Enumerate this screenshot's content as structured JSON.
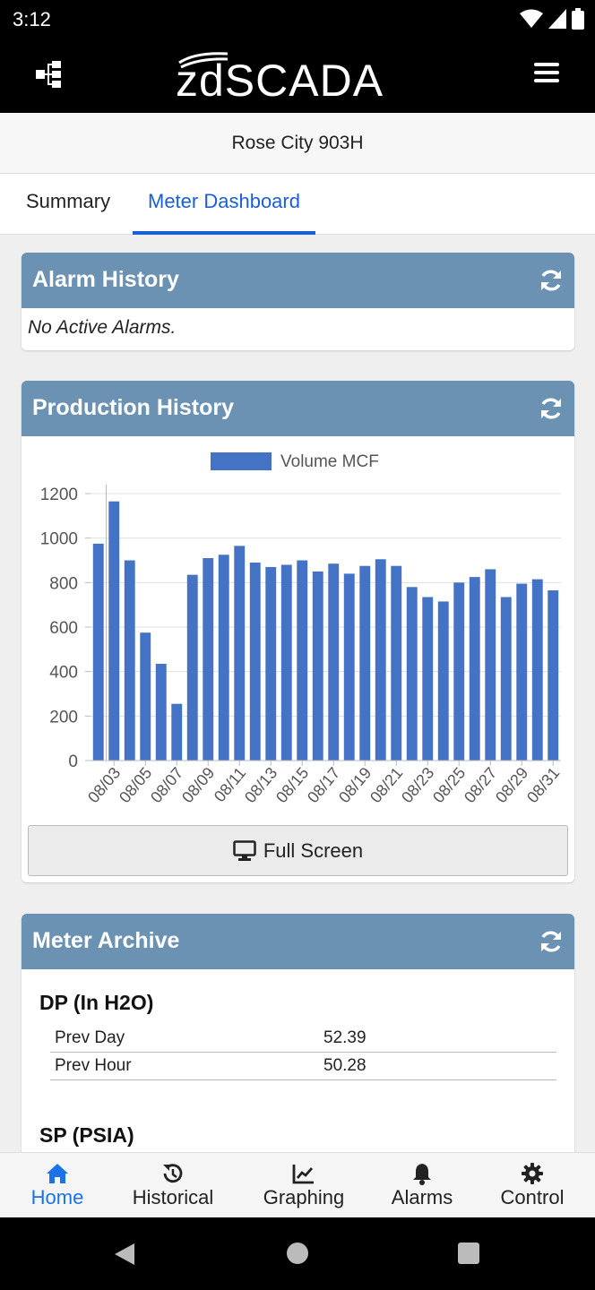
{
  "status_bar": {
    "time": "3:12"
  },
  "header": {
    "logo_text": "zdSCADA"
  },
  "site": {
    "title": "Rose City 903H"
  },
  "tabs": [
    {
      "label": "Summary",
      "active": false
    },
    {
      "label": "Meter Dashboard",
      "active": true
    }
  ],
  "alarm_history": {
    "title": "Alarm History",
    "message": "No Active Alarms."
  },
  "production_history": {
    "title": "Production History",
    "full_screen_label": "Full Screen"
  },
  "chart_data": {
    "type": "bar",
    "legend": [
      "Volume MCF"
    ],
    "legend_position": "top",
    "categories": [
      "08/02",
      "08/03",
      "08/04",
      "08/05",
      "08/06",
      "08/07",
      "08/08",
      "08/09",
      "08/10",
      "08/11",
      "08/12",
      "08/13",
      "08/14",
      "08/15",
      "08/16",
      "08/17",
      "08/18",
      "08/19",
      "08/20",
      "08/21",
      "08/22",
      "08/23",
      "08/24",
      "08/25",
      "08/26",
      "08/27",
      "08/28",
      "08/29",
      "08/30",
      "08/31"
    ],
    "tick_labels": [
      "08/03",
      "08/05",
      "08/07",
      "08/09",
      "08/11",
      "08/13",
      "08/15",
      "08/17",
      "08/19",
      "08/21",
      "08/23",
      "08/25",
      "08/27",
      "08/29",
      "08/31"
    ],
    "series": [
      {
        "name": "Volume MCF",
        "color": "#4472c4",
        "values": [
          975,
          1165,
          900,
          575,
          435,
          255,
          835,
          910,
          925,
          965,
          890,
          870,
          880,
          900,
          850,
          885,
          840,
          875,
          905,
          875,
          780,
          735,
          715,
          800,
          825,
          860,
          735,
          795,
          815,
          765
        ]
      }
    ],
    "y_ticks": [
      "0",
      "200",
      "400",
      "600",
      "800",
      "1000",
      "1200"
    ],
    "ylim": [
      0,
      1200
    ],
    "grid": true
  },
  "meter_archive": {
    "title": "Meter Archive",
    "groups": [
      {
        "title": "DP (In H2O)",
        "rows": [
          {
            "label": "Prev Day",
            "value": "52.39"
          },
          {
            "label": "Prev Hour",
            "value": "50.28"
          }
        ]
      },
      {
        "title": "SP (PSIA)",
        "rows": []
      }
    ]
  },
  "bottom_nav": [
    {
      "label": "Home",
      "icon": "home-icon",
      "active": true
    },
    {
      "label": "Historical",
      "icon": "history-icon",
      "active": false
    },
    {
      "label": "Graphing",
      "icon": "chart-line-icon",
      "active": false
    },
    {
      "label": "Alarms",
      "icon": "bell-icon",
      "active": false
    },
    {
      "label": "Control",
      "icon": "gear-icon",
      "active": false
    }
  ],
  "colors": {
    "accent": "#1a73e8",
    "card_header": "#6c92b3",
    "bar": "#4472c4"
  }
}
